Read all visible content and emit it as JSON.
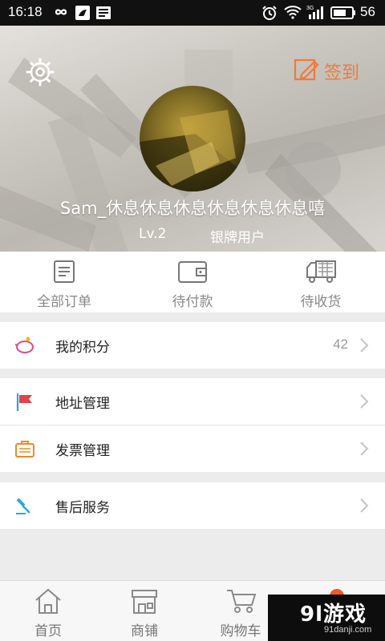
{
  "status_bar": {
    "time": "16:18",
    "battery_level": "56",
    "icons": [
      "infinity-icon",
      "app-notification-icon",
      "news-icon",
      "alarm-icon",
      "wifi-icon",
      "signal-3g-icon",
      "battery-icon"
    ]
  },
  "profile": {
    "settings_icon": "gear-icon",
    "checkin_label": "签到",
    "checkin_color": "#f07a3a",
    "username": "Sam_休息休息休息休息休息休息嘻",
    "level": "Lv.2",
    "member_tier": "银牌用户"
  },
  "orders": [
    {
      "label": "全部订单",
      "icon": "order-list-icon"
    },
    {
      "label": "待付款",
      "icon": "wallet-icon"
    },
    {
      "label": "待收货",
      "icon": "delivery-truck-icon"
    }
  ],
  "menu": {
    "points": {
      "label": "我的积分",
      "value": "42",
      "icon": "piggy-bank-icon"
    },
    "address": {
      "label": "地址管理",
      "icon": "flag-icon"
    },
    "invoice": {
      "label": "发票管理",
      "icon": "invoice-case-icon"
    },
    "aftersale": {
      "label": "售后服务",
      "icon": "hammer-icon"
    }
  },
  "bottom_nav": [
    {
      "label": "首页",
      "icon": "home-icon"
    },
    {
      "label": "商铺",
      "icon": "store-icon"
    },
    {
      "label": "购物车",
      "icon": "cart-icon"
    },
    {
      "label": "",
      "icon": "profile-dot-icon",
      "accent": "#ef5a28"
    }
  ],
  "watermark": {
    "main": "9l游戏",
    "sub": "91danji.com"
  }
}
